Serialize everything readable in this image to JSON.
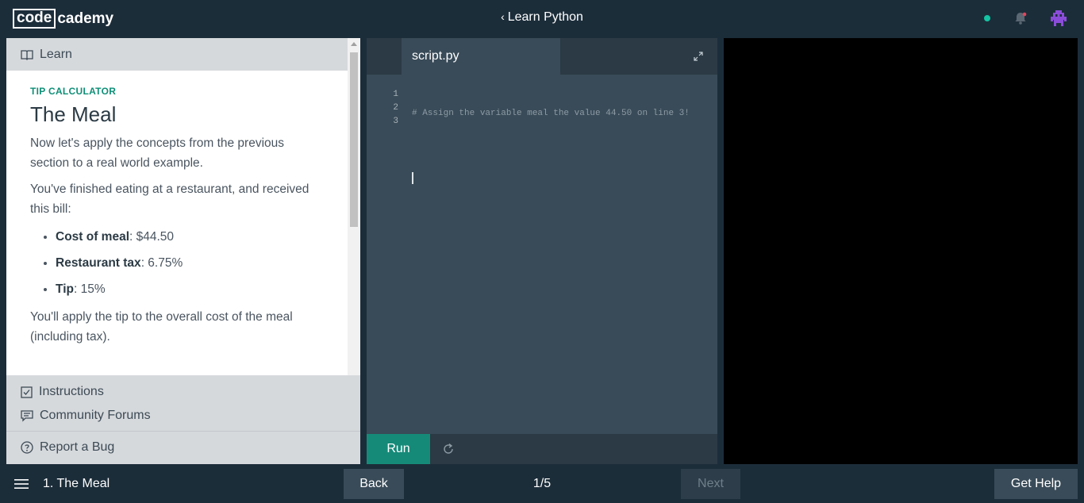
{
  "header": {
    "logo_box": "code",
    "logo_rest": "cademy",
    "breadcrumb": "Learn Python",
    "status_color": "#14c3a2",
    "icons": [
      "bell-icon",
      "avatar-icon"
    ]
  },
  "left_panel": {
    "learn_label": "Learn",
    "kicker": "TIP CALCULATOR",
    "title": "The Meal",
    "intro": "Now let's apply the concepts from the previous section to a real world example.",
    "bill_intro": "You've finished eating at a restaurant, and received this bill:",
    "bill_items": [
      {
        "label": "Cost of meal",
        "value": ": $44.50"
      },
      {
        "label": "Restaurant tax",
        "value": ": 6.75%"
      },
      {
        "label": "Tip",
        "value": ": 15%"
      }
    ],
    "outro": "You'll apply the tip to the overall cost of the meal (including tax).",
    "instructions_label": "Instructions",
    "forums_label": "Community Forums",
    "report_label": "Report a Bug"
  },
  "editor": {
    "tab_name": "script.py",
    "line_numbers": [
      "1",
      "2",
      "3"
    ],
    "code_lines": [
      "# Assign the variable meal the value 44.50 on line 3!",
      "",
      ""
    ],
    "run_label": "Run",
    "accent_color": "#168a79"
  },
  "footer": {
    "lesson_label": "1. The Meal",
    "back_label": "Back",
    "pager": "1/5",
    "next_label": "Next",
    "help_label": "Get Help"
  }
}
